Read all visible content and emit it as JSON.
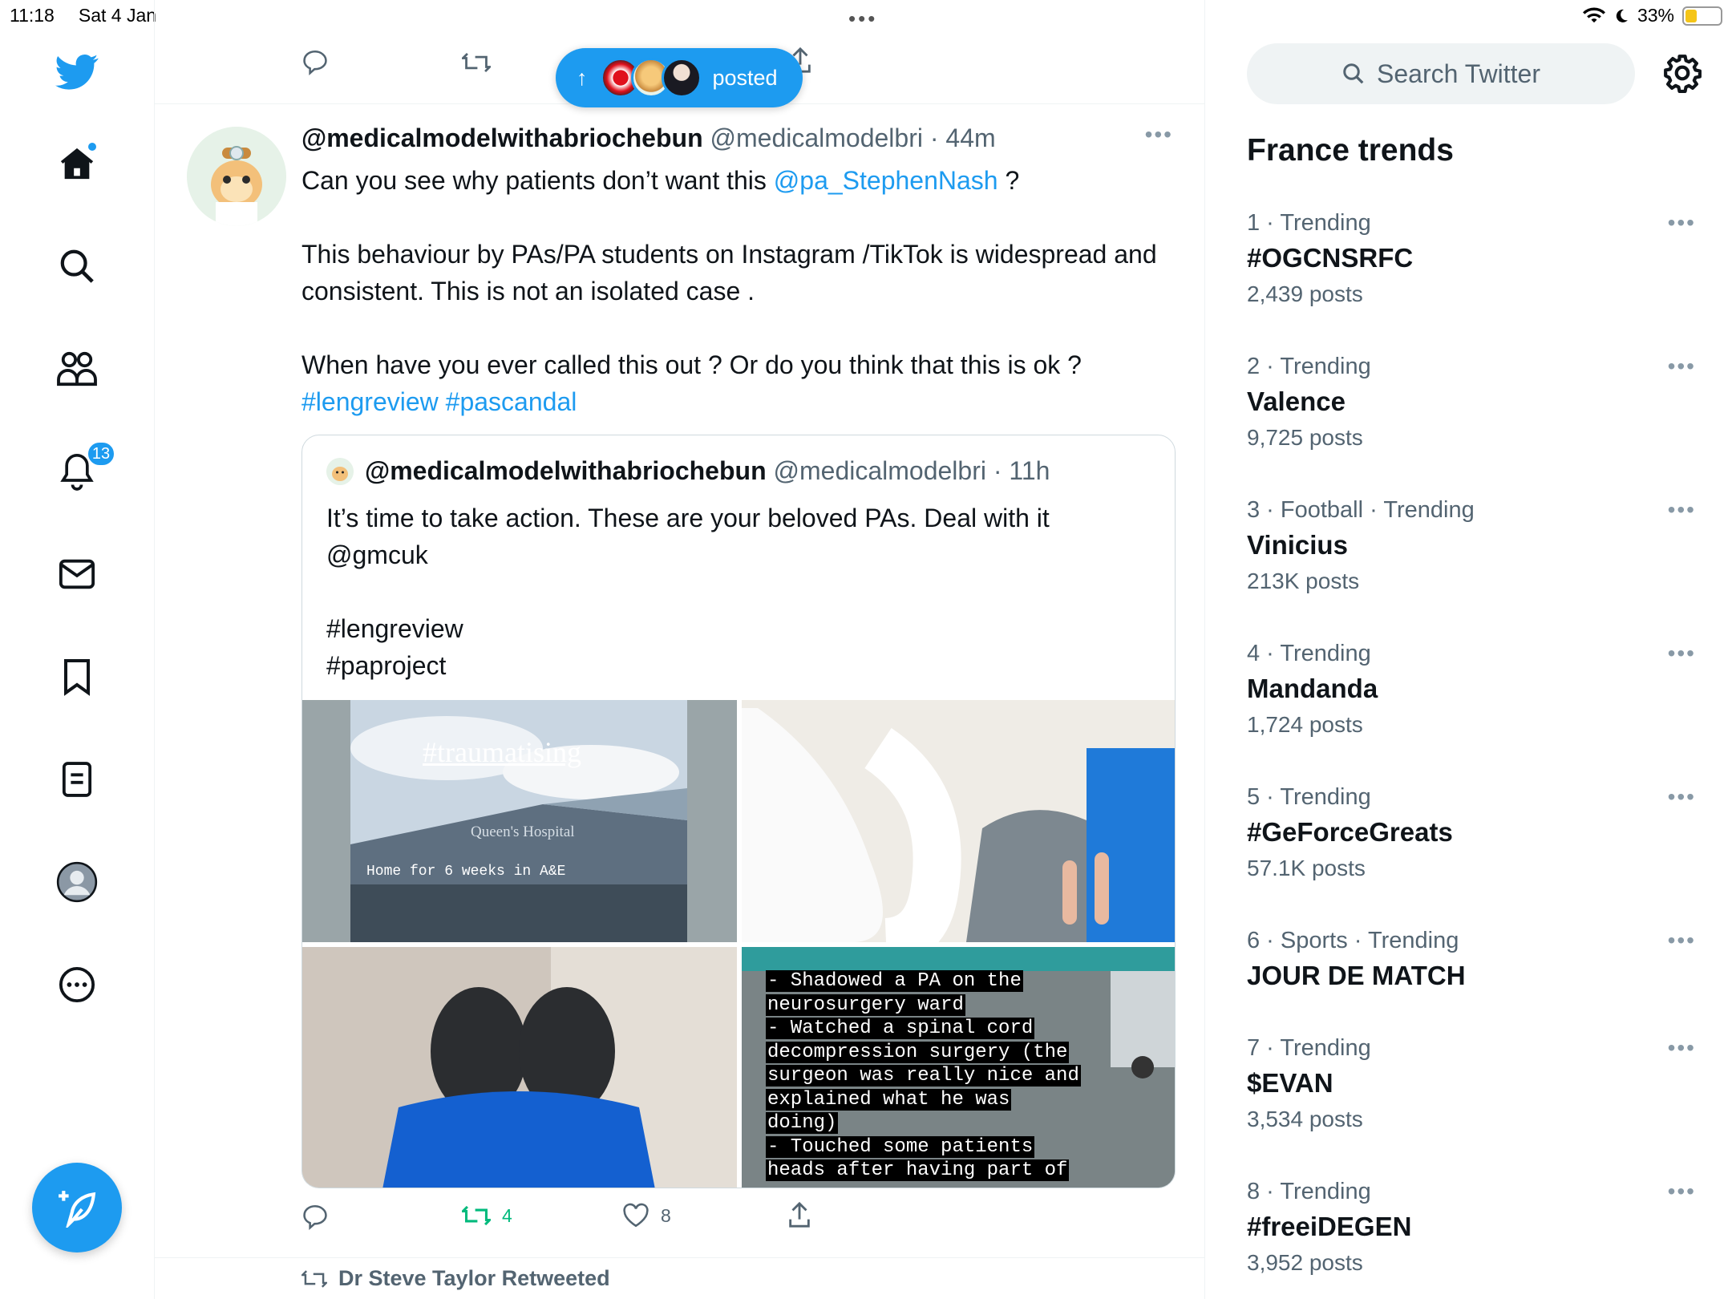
{
  "status": {
    "time": "11:18",
    "date": "Sat 4 Jan",
    "battery": "33%",
    "battery_level": 0.33
  },
  "nav": {
    "notifications_badge": "13"
  },
  "pill": {
    "label": "posted"
  },
  "tweet": {
    "name": "@medicalmodelwithabriochebun",
    "handle": "@medicalmodelbri",
    "time": "· 44m",
    "line1_pre": "Can you see why patients don’t want this ",
    "line1_mention": "@pa_StephenNash",
    "line1_post": " ?",
    "para2": "This behaviour by PAs/PA students on Instagram /TikTok is widespread and consistent. This is not an isolated case .",
    "para3": "When have you ever called this out ? Or do you think that this is ok ?",
    "hashtag1": "#lengreview",
    "hashtag2": "#pascandal",
    "retweets": "4",
    "likes": "8"
  },
  "quote": {
    "name": "@medicalmodelwithabriochebun",
    "handle": "@medicalmodelbri",
    "time": "· 11h",
    "line1": "It’s time to take action. These are your beloved PAs. Deal with it",
    "line2": "@gmcuk",
    "tag1": "#lengreview",
    "tag2": "#paproject",
    "media1_title": "#traumatising",
    "media1_sign": "Queen's Hospital",
    "media1_caption": "Home for 6 weeks in A&E",
    "media4_lines": [
      "- Shadowed a PA on the",
      "neurosurgery ward",
      "- Watched a spinal cord",
      "decompression surgery (the",
      "surgeon was really nice and",
      "explained what he was",
      "doing)",
      "- Touched some patients",
      "heads after having part of"
    ]
  },
  "retweeted_by": "Dr Steve Taylor Retweeted",
  "search": {
    "placeholder": "Search Twitter"
  },
  "trends_title": "France trends",
  "trends": [
    {
      "meta": "1 · Trending",
      "name": "#OGCNSRFC",
      "count": "2,439 posts"
    },
    {
      "meta": "2 · Trending",
      "name": "Valence",
      "count": "9,725 posts"
    },
    {
      "meta": "3 · Football · Trending",
      "name": "Vinicius",
      "count": "213K posts"
    },
    {
      "meta": "4 · Trending",
      "name": "Mandanda",
      "count": "1,724 posts"
    },
    {
      "meta": "5 · Trending",
      "name": "#GeForceGreats",
      "count": "57.1K posts"
    },
    {
      "meta": "6 · Sports · Trending",
      "name": "JOUR DE MATCH",
      "count": ""
    },
    {
      "meta": "7 · Trending",
      "name": "$EVAN",
      "count": "3,534 posts"
    },
    {
      "meta": "8 · Trending",
      "name": "#freeiDEGEN",
      "count": "3,952 posts"
    }
  ],
  "colors": {
    "accent": "#1d9bf0",
    "retweet": "#00ba7c",
    "muted": "#536471"
  }
}
